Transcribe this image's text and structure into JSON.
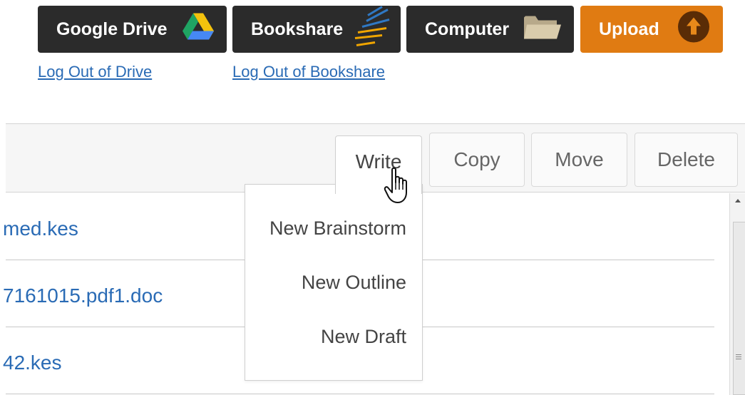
{
  "sources": {
    "drive": {
      "label": "Google Drive",
      "icon": "google-drive-icon"
    },
    "bookshare": {
      "label": "Bookshare",
      "icon": "bookshare-icon"
    },
    "computer": {
      "label": "Computer",
      "icon": "folder-icon"
    },
    "upload": {
      "label": "Upload",
      "icon": "upload-arrow-icon",
      "color": "#e07b12"
    }
  },
  "logout": {
    "drive": "Log Out of Drive",
    "bookshare": "Log Out of Bookshare"
  },
  "toolbar": {
    "write": "Write",
    "copy": "Copy",
    "move": "Move",
    "delete": "Delete"
  },
  "write_menu": {
    "items": [
      "New Brainstorm",
      "New Outline",
      "New Draft"
    ]
  },
  "files": [
    "med.kes",
    "7161015.pdf1.doc",
    "42.kes"
  ],
  "colors": {
    "dark_button": "#2b2b2b",
    "link": "#2a6bb5",
    "upload": "#e07b12"
  }
}
